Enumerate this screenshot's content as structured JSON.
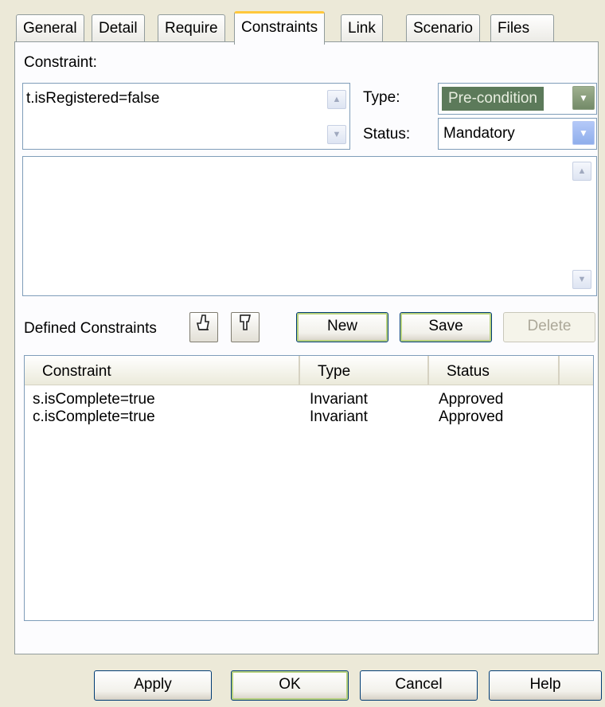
{
  "tabs": [
    "General",
    "Detail",
    "Require",
    "Constraints",
    "Link",
    "Scenario",
    "Files"
  ],
  "active_tab": "Constraints",
  "constraint": {
    "label": "Constraint:",
    "value": "t.isRegistered=false"
  },
  "type": {
    "label": "Type:",
    "value": "Pre-condition"
  },
  "status": {
    "label": "Status:",
    "value": "Mandatory"
  },
  "defined": {
    "label": "Defined Constraints",
    "new_label": "New",
    "save_label": "Save",
    "delete_label": "Delete"
  },
  "table": {
    "columns": [
      "Constraint",
      "Type",
      "Status"
    ],
    "rows": [
      {
        "constraint": "s.isComplete=true",
        "type": "Invariant",
        "status": "Approved"
      },
      {
        "constraint": "c.isComplete=true",
        "type": "Invariant",
        "status": "Approved"
      }
    ]
  },
  "footer": {
    "apply": "Apply",
    "ok": "OK",
    "cancel": "Cancel",
    "help": "Help"
  },
  "icons": {
    "move_up": "hand-up-icon",
    "move_down": "hand-down-icon",
    "scroll_up": "scroll-up-arrow",
    "scroll_down": "scroll-down-arrow",
    "dropdown": "chevron-down-icon"
  }
}
